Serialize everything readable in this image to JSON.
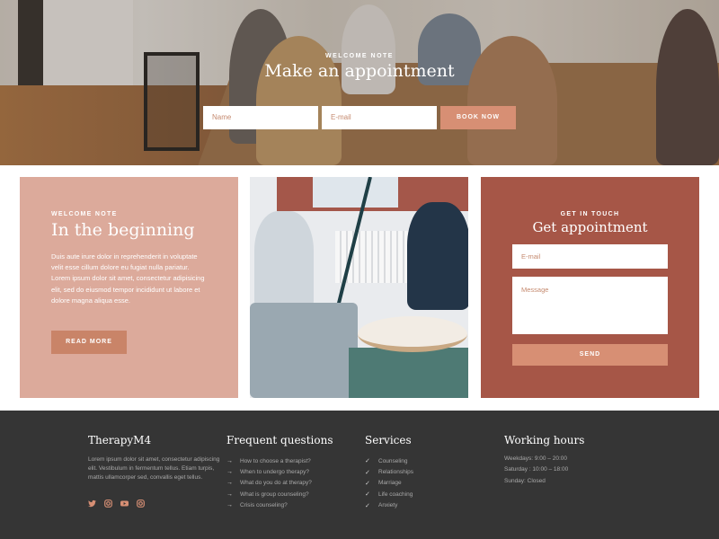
{
  "hero": {
    "kicker": "WELCOME NOTE",
    "title": "Make an appointment",
    "name_placeholder": "Name",
    "email_placeholder": "E-mail",
    "button": "BOOK NOW"
  },
  "intro": {
    "kicker": "WELCOME NOTE",
    "title": "In the beginning",
    "body": "Duis aute irure dolor in reprehenderit in voluptate velit esse cillum dolore eu fugiat nulla pariatur. Lorem ipsum dolor sit amet, consectetur adipisicing elit, sed do eiusmod tempor incididunt ut labore et dolore magna aliqua esse.",
    "button": "READ MORE"
  },
  "contact": {
    "kicker": "GET IN TOUCH",
    "title": "Get appointment",
    "email_placeholder": "E-mail",
    "message_placeholder": "Message",
    "button": "SEND"
  },
  "footer": {
    "brand": {
      "name": "TherapyM4",
      "text": "Lorem ipsum dolor sit amet, consectetur adipiscing elit. Vestibulum in fermentum tellus. Etiam turpis, mattis ullamcorper sed, convallis eget tellus.",
      "social": [
        "twitter-icon",
        "instagram-icon",
        "youtube-icon",
        "instagram-icon"
      ]
    },
    "faq": {
      "title": "Frequent questions",
      "items": [
        "How to choose a therapist?",
        "When to undergo therapy?",
        "What do you do at therapy?",
        "What is group counseling?",
        "Crisis counseling?"
      ]
    },
    "services": {
      "title": "Services",
      "items": [
        "Counseling",
        "Relationships",
        "Marriage",
        "Life coaching",
        "Anxiety"
      ]
    },
    "hours": {
      "title": "Working hours",
      "lines": [
        "Weekdays: 9:00 – 20:00",
        "Saturday : 10:00 – 18:00",
        "Sunday: Closed"
      ]
    }
  },
  "colors": {
    "accent": "#d78f74",
    "card_left": "#dcaa9b",
    "card_right": "#a65647",
    "footer": "#353535"
  }
}
